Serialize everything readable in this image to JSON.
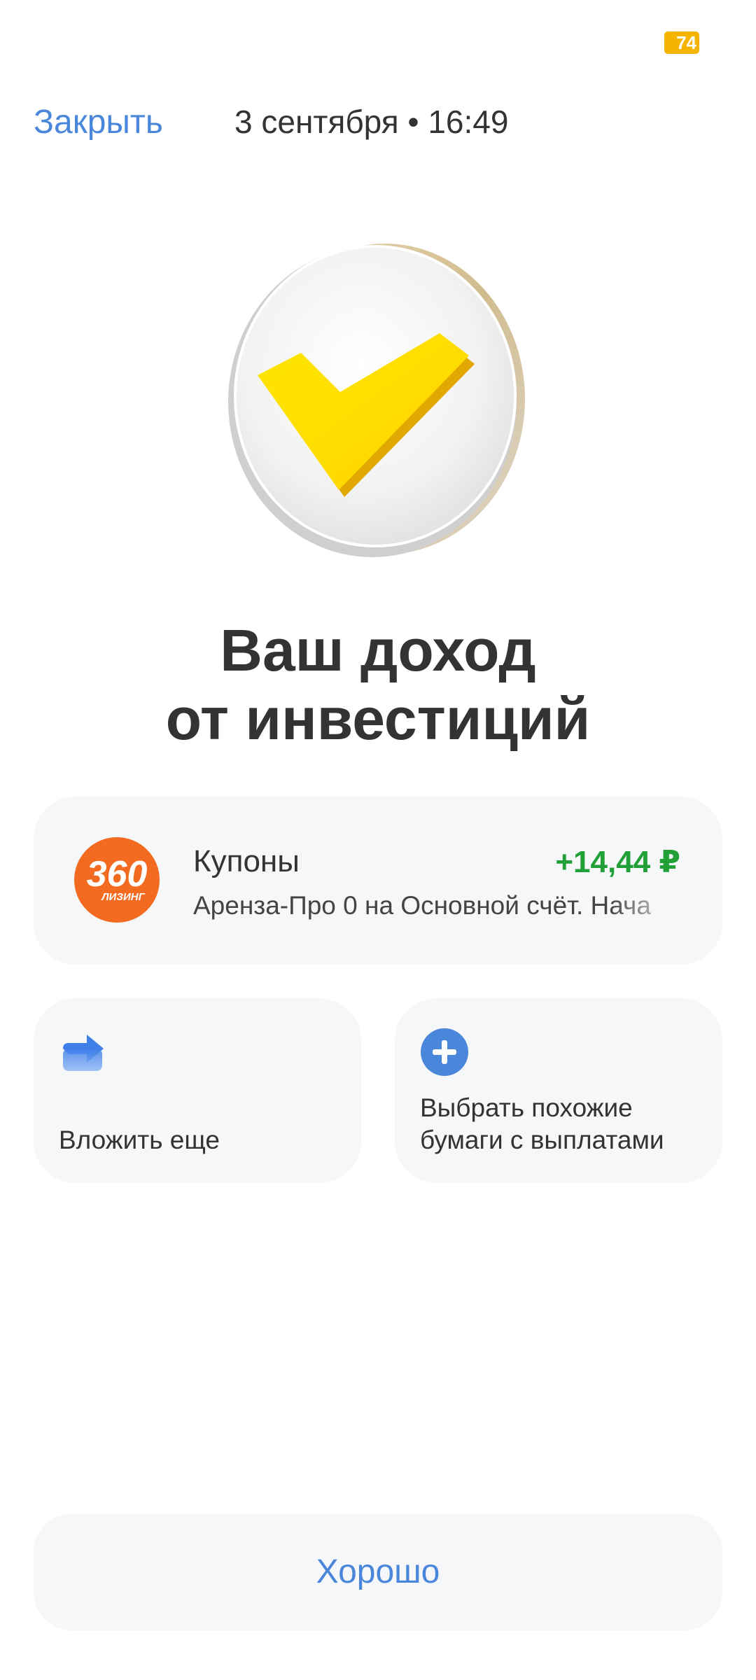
{
  "status_bar": {
    "battery": "74"
  },
  "header": {
    "close_label": "Закрыть",
    "date_time": "3 сентября • 16:49"
  },
  "hero": {
    "icon": "checkmark-coin-icon"
  },
  "title": {
    "line1": "Ваш доход",
    "line2": "от инвестиций"
  },
  "coupon": {
    "logo_icon": "360-leasing-logo",
    "logo_text_main": "360",
    "logo_text_sub": "ЛИЗИНГ",
    "title": "Купоны",
    "amount": "+14,44 ₽",
    "description": "Аренза-Про 0 на Основной счёт. Нача"
  },
  "actions": [
    {
      "icon": "share-arrow-icon",
      "label_line1": "Вложить еще",
      "label_line2": ""
    },
    {
      "icon": "plus-circle-icon",
      "label_line1": "Выбрать похожие",
      "label_line2": "бумаги с выплатами"
    }
  ],
  "footer": {
    "ok_label": "Хорошо"
  },
  "colors": {
    "accent": "#4a87db",
    "positive": "#21a038",
    "card_bg": "#f6f7f8",
    "battery": "#f5b400",
    "check_yellow": "#ffe000",
    "logo_orange": "#f26b21"
  }
}
